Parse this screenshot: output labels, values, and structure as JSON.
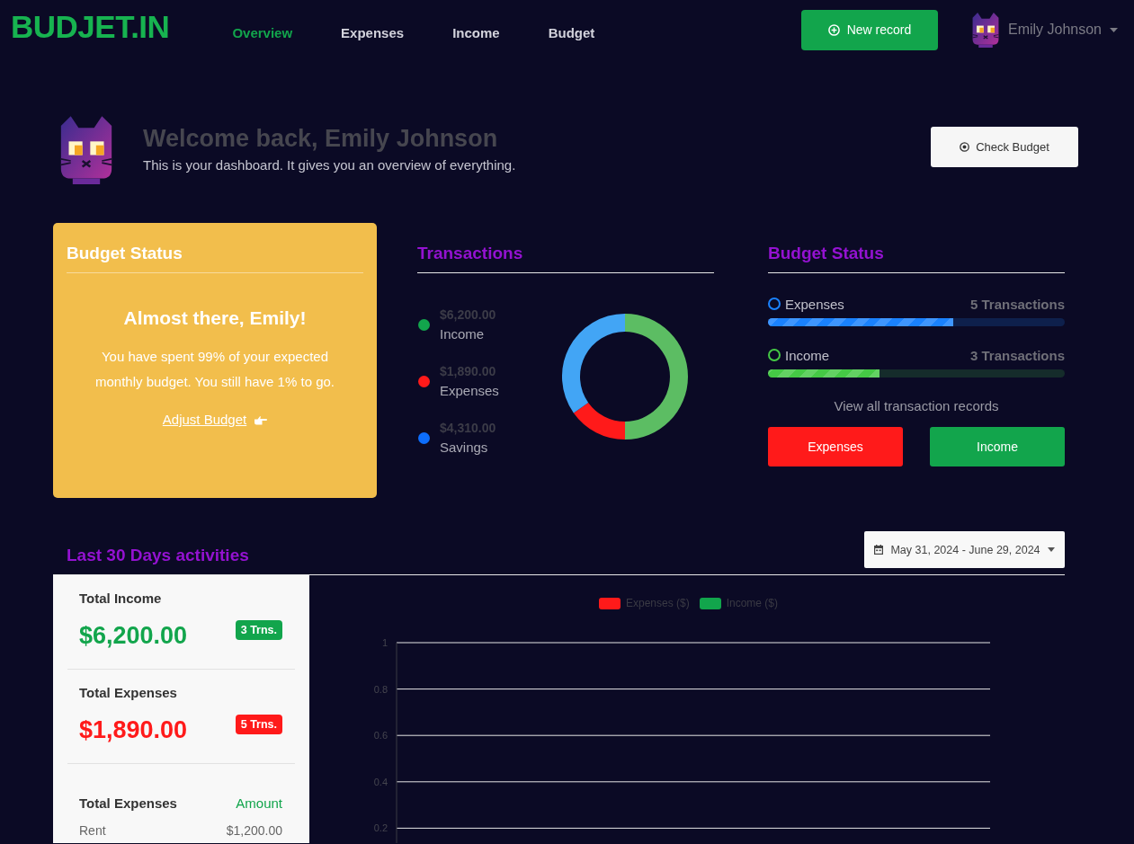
{
  "nav": {
    "logo": "BUDJET.IN",
    "links": [
      {
        "label": "Overview",
        "selected": true
      },
      {
        "label": "Expenses",
        "selected": false
      },
      {
        "label": "Income",
        "selected": false
      },
      {
        "label": "Budget",
        "selected": false
      }
    ],
    "new_record_button": "New record",
    "user_name": "Emily Johnson"
  },
  "welcome": {
    "title": "Welcome back, Emily Johnson",
    "subtitle": "This is your dashboard. It gives you an overview of everything.",
    "check_budget_button": "Check Budget"
  },
  "budget_card": {
    "title": "Budget Status",
    "heading": "Almost there, Emily!",
    "message": "You have spent 99% of your expected monthly budget. You still have 1% to go.",
    "link": "Adjust Budget"
  },
  "transactions": {
    "title": "Transactions",
    "legend": [
      {
        "amount": "$6,200.00",
        "label": "Income",
        "color": "#12a54c"
      },
      {
        "amount": "$1,890.00",
        "label": "Expenses",
        "color": "#ff1a1a"
      },
      {
        "amount": "$4,310.00",
        "label": "Savings",
        "color": "#0d6efd"
      }
    ],
    "chart_data": {
      "type": "donut",
      "values": [
        50,
        15.2,
        34.8
      ],
      "colors": [
        "#5cbd63",
        "#ff1a1a",
        "#42a5f5"
      ]
    }
  },
  "budget_status": {
    "title": "Budget Status",
    "bars": [
      {
        "label": "Expenses",
        "count": "5 Transactions",
        "level": 0.625,
        "color": "#1a82ff"
      },
      {
        "label": "Income",
        "count": "3 Transactions",
        "level": 0.375,
        "color": "#45c945"
      }
    ],
    "caption": "View all transaction records",
    "buttons": [
      {
        "label": "Expenses",
        "kind": "expense"
      },
      {
        "label": "Income",
        "kind": "income"
      }
    ]
  },
  "activities": {
    "title": "Last 30 Days activities",
    "date_range": "May 31, 2024 - June 29, 2024",
    "summary": [
      {
        "label": "Total Income",
        "amount": "$6,200.00",
        "badge": "3 Trns.",
        "kind": "income"
      },
      {
        "label": "Total Expenses",
        "amount": "$1,890.00",
        "badge": "5 Trns.",
        "kind": "expense"
      }
    ],
    "table": {
      "columns": [
        "Total Expenses",
        "Amount"
      ],
      "rows": [
        [
          "Rent",
          "$1,200.00"
        ]
      ]
    },
    "chart_data": {
      "type": "bar",
      "series": [
        {
          "name": "Expenses ($)",
          "color": "#ff1a1a"
        },
        {
          "name": "Income ($)",
          "color": "#12a54c"
        }
      ],
      "ylim": [
        0,
        1
      ],
      "yticks": [
        0.2,
        0.4,
        0.6,
        0.8,
        1
      ],
      "grid": true
    }
  }
}
